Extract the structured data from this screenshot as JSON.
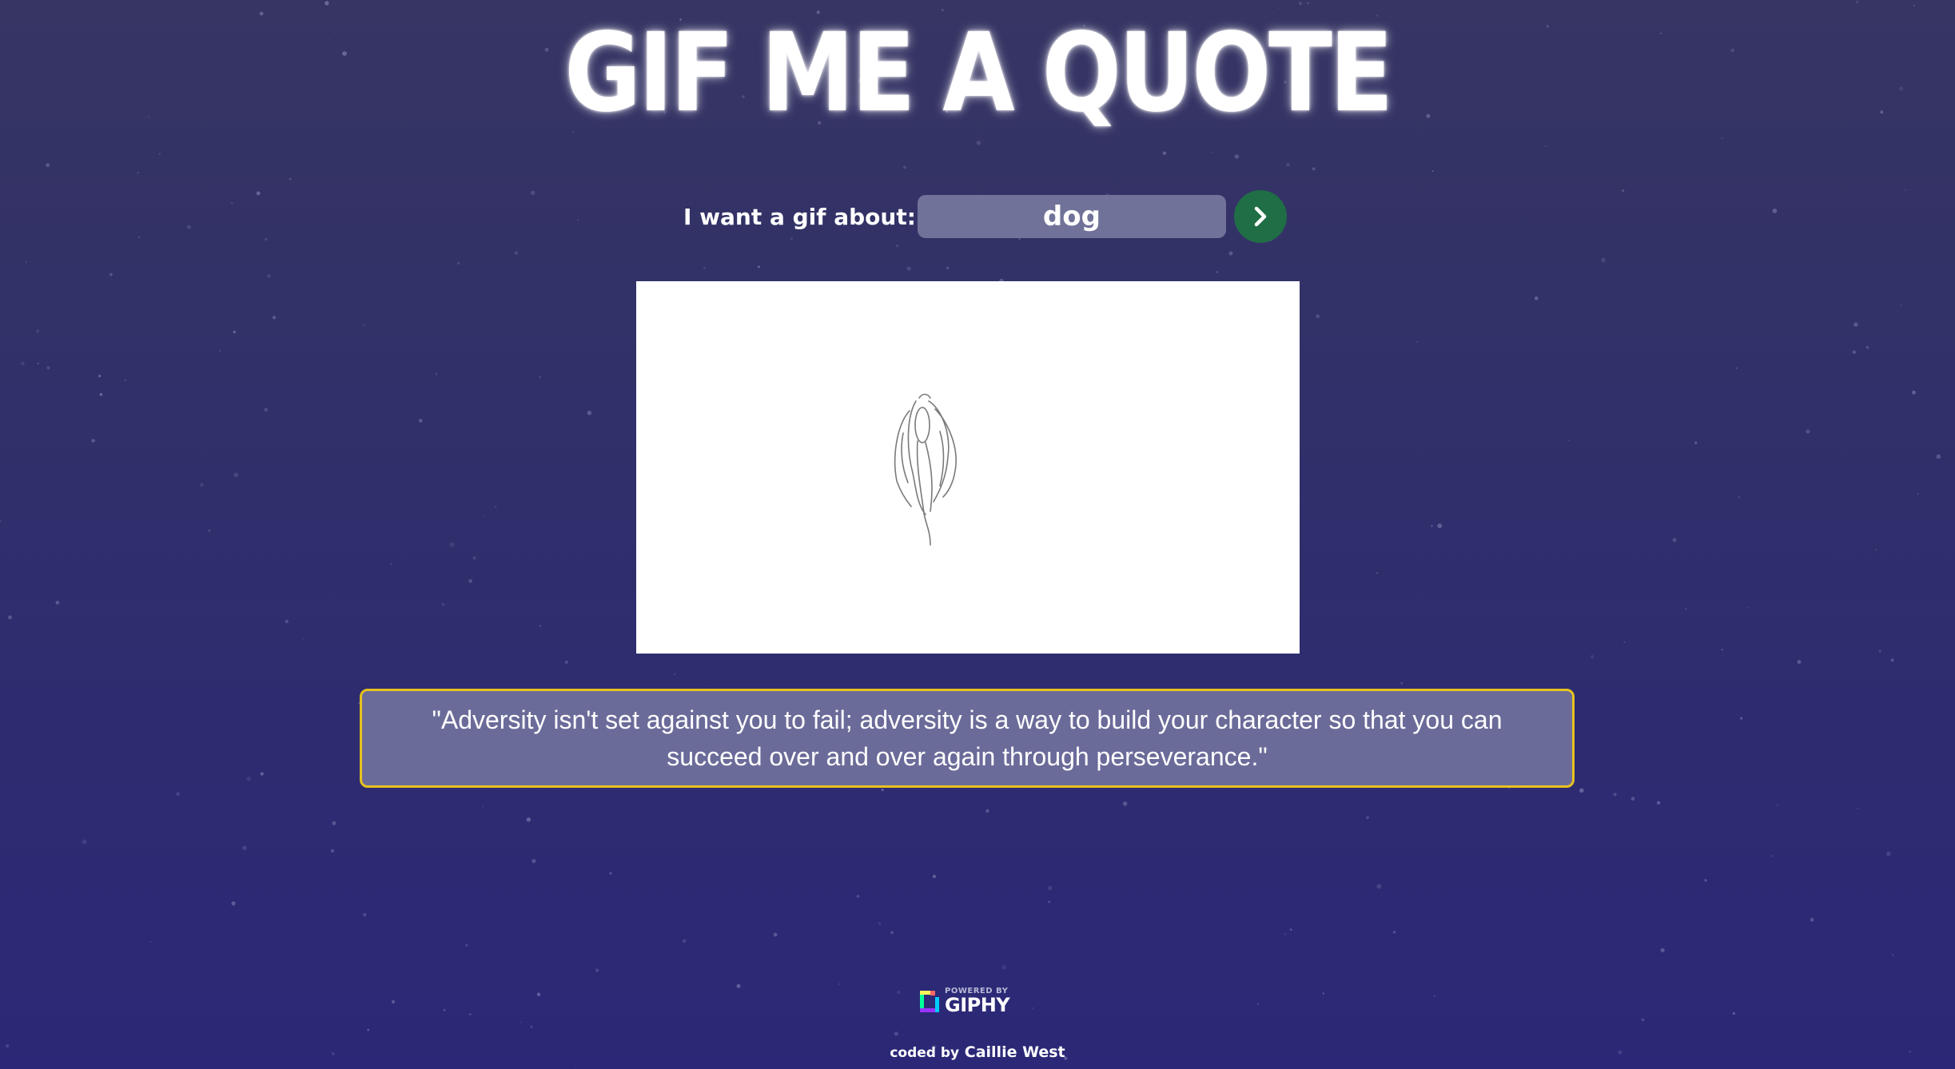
{
  "page": {
    "title": "GIF ME A QUOTE"
  },
  "search": {
    "label": "I want a gif about:",
    "value": "dog",
    "submit_icon": "chevron-right-icon"
  },
  "gif": {
    "description_icon": "sketch-gif"
  },
  "quote": {
    "text": "\"Adversity isn't set against you to fail; adversity is a way to build your character so that you can succeed over and over again through perseverance.\""
  },
  "footer": {
    "powered_by": "POWERED BY",
    "brand": "GIPHY",
    "credit_prefix": "coded by",
    "credit_name": "Caillie West"
  },
  "colors": {
    "accent_border": "#e6c21e",
    "go_button": "#1f6e46",
    "input_bg": "#717299",
    "quote_bg": "#6b6b9a"
  }
}
